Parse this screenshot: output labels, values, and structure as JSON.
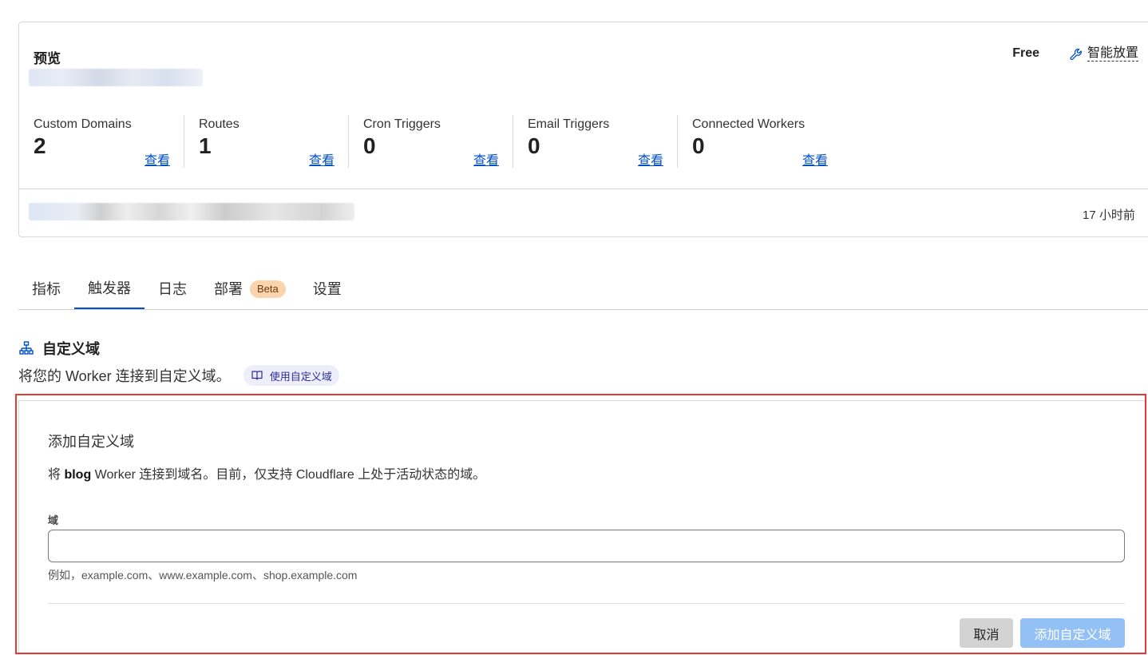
{
  "preview": {
    "title": "预览",
    "plan": "Free",
    "smart_placement_label": "智能放置",
    "smart_placement_icon": "wrench-icon",
    "last_updated": "17 小时前",
    "metrics": [
      {
        "label": "Custom Domains",
        "value": "2",
        "link": "查看"
      },
      {
        "label": "Routes",
        "value": "1",
        "link": "查看"
      },
      {
        "label": "Cron Triggers",
        "value": "0",
        "link": "查看"
      },
      {
        "label": "Email Triggers",
        "value": "0",
        "link": "查看"
      },
      {
        "label": "Connected Workers",
        "value": "0",
        "link": "查看"
      }
    ]
  },
  "tabs": [
    {
      "label": "指标",
      "active": false
    },
    {
      "label": "触发器",
      "active": true
    },
    {
      "label": "日志",
      "active": false
    },
    {
      "label": "部署",
      "badge": "Beta",
      "active": false
    },
    {
      "label": "设置",
      "active": false
    }
  ],
  "section": {
    "icon": "sitemap-icon",
    "title": "自定义域",
    "description": "将您的 Worker 连接到自定义域。",
    "doc_link": "使用自定义域",
    "doc_icon": "book-icon"
  },
  "form": {
    "title": "添加自定义域",
    "desc_prefix": "将 ",
    "desc_worker": "blog",
    "desc_suffix": " Worker 连接到域名。目前，仅支持 Cloudflare 上处于活动状态的域。",
    "field_label": "域",
    "field_value": "",
    "hint": "例如，example.com、www.example.com、shop.example.com",
    "cancel_label": "取消",
    "submit_label": "添加自定义域"
  },
  "colors": {
    "accent": "#0051c3",
    "badge_bg": "#fbd3ad",
    "highlight": "#e53935",
    "submit_disabled": "#93c0f5"
  }
}
